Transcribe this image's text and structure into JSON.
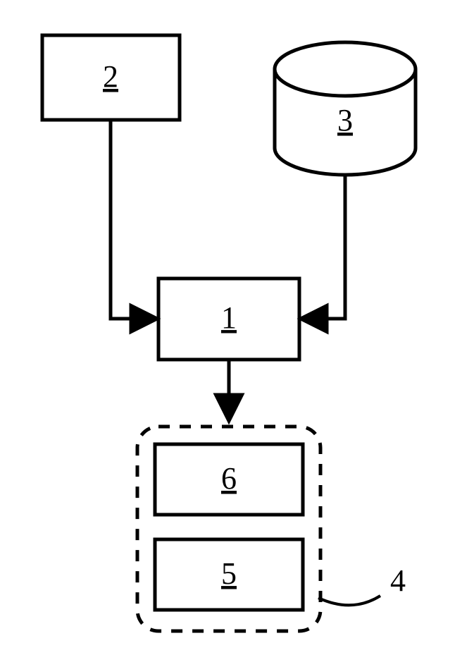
{
  "diagram": {
    "blocks": {
      "topLeft": {
        "label": "2"
      },
      "topRight": {
        "label": "3"
      },
      "center": {
        "label": "1"
      },
      "innerTop": {
        "label": "6"
      },
      "innerBottom": {
        "label": "5"
      },
      "groupLabel": "4"
    }
  }
}
